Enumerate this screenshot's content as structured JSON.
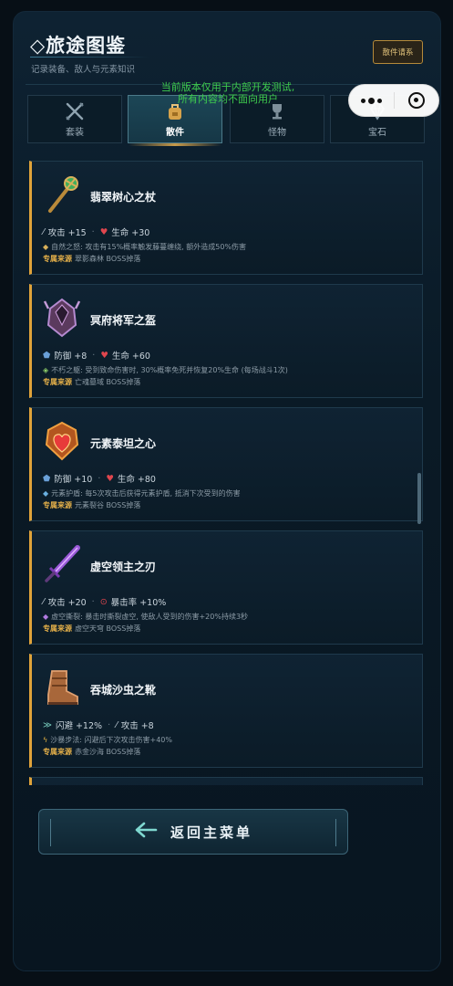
{
  "header": {
    "title": "◇旅途图鉴",
    "subtitle": "记录装备、敌人与元素知识",
    "codex_button": "散件请系"
  },
  "notice": {
    "line1": "当前版本仅用于内部开发测试,",
    "line2": "所有内容均不面向用户"
  },
  "tabs": [
    {
      "label": "套装",
      "icon": "crossed-swords-icon",
      "active": false
    },
    {
      "label": "散件",
      "icon": "backpack-icon",
      "active": true
    },
    {
      "label": "怪物",
      "icon": "trophy-icon",
      "active": false
    },
    {
      "label": "宝石",
      "icon": "diamond-icon",
      "active": false
    }
  ],
  "items": [
    {
      "name": "翡翠树心之杖",
      "icon": "emerald-staff-icon",
      "stat1": "攻击 +15",
      "stat2": "生命 +30",
      "desc": "自然之怒: 攻击有15%概率触发藤蔓缠绕, 额外造成50%伤害",
      "source_label": "专属来源",
      "source": "翠影森林 BOSS掉落"
    },
    {
      "name": "冥府将军之盔",
      "icon": "dark-helm-icon",
      "stat1": "防御 +8",
      "stat2": "生命 +60",
      "desc": "不朽之躯: 受到致命伤害时, 30%概率免死并恢复20%生命 (每场战斗1次)",
      "source_label": "专属来源",
      "source": "亡魂墓域 BOSS掉落"
    },
    {
      "name": "元素泰坦之心",
      "icon": "titan-heart-icon",
      "stat1": "防御 +10",
      "stat2": "生命 +80",
      "desc": "元素护盾: 每5次攻击后获得元素护盾, 抵消下次受到的伤害",
      "source_label": "专属来源",
      "source": "元素裂谷 BOSS掉落"
    },
    {
      "name": "虚空领主之刃",
      "icon": "void-blade-icon",
      "stat1": "攻击 +20",
      "stat2": "暴击率 +10%",
      "desc": "虚空撕裂: 暴击时撕裂虚空, 使敌人受到的伤害+20%持续3秒",
      "source_label": "专属来源",
      "source": "虚空天穹 BOSS掉落"
    },
    {
      "name": "吞城沙虫之靴",
      "icon": "sandworm-boots-icon",
      "stat1": "闪避 +12%",
      "stat2": "攻击 +8",
      "desc": "沙暴步法: 闪避后下次攻击伤害+40%",
      "source_label": "专属来源",
      "source": "赤金沙海 BOSS掉落"
    }
  ],
  "back_button": {
    "label": "返回主菜单",
    "icon": "arrow-left-icon"
  },
  "colors": {
    "accent_gold": "#e0a33a",
    "notice_green": "#3ecb4e",
    "panel": "#0e2232"
  }
}
